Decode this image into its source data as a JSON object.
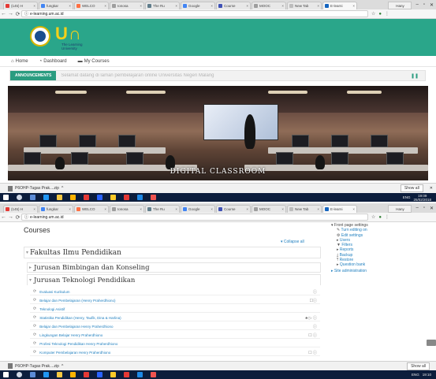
{
  "browser_top": {
    "tabs": [
      {
        "label": "(145) H",
        "color": "#e53935"
      },
      {
        "label": "fungkar",
        "color": "#4285f4"
      },
      {
        "label": "WELCO",
        "color": "#ff7043"
      },
      {
        "label": "Ionosa",
        "color": "#9e9e9e"
      },
      {
        "label": "The Ru",
        "color": "#607d8b"
      },
      {
        "label": "Google",
        "color": "#4285f4"
      },
      {
        "label": "Course",
        "color": "#3f51b5"
      },
      {
        "label": "MOOC",
        "color": "#9e9e9e"
      },
      {
        "label": "New Tab",
        "color": "#bdbdbd"
      },
      {
        "label": "E-learni",
        "color": "#1565c0"
      }
    ],
    "user": "Hany",
    "url": "e-learning.um.ac.id"
  },
  "moodle_top": {
    "logo_letters": "U∩",
    "logo_sub": "The Learning University",
    "nav": {
      "home": "Home",
      "dashboard": "Dashboard",
      "my_courses": "My Courses"
    },
    "announcement_label": "ANNOUNCEMENTS",
    "announcement_text": "Selamat datang di laman pembelajaran online Universitas Negeri Malang",
    "banner_caption": "DIGITAL CLASSROOM"
  },
  "download_top": {
    "file": "P6OHP-Tugas Prak....zip",
    "show_all": "Show all"
  },
  "taskbar_top": {
    "lang": "ENG",
    "time": "19:09",
    "date": "25/02/2018"
  },
  "browser_bottom": {
    "tabs": [
      {
        "label": "(145) H",
        "color": "#e53935"
      },
      {
        "label": "fungkar",
        "color": "#4285f4"
      },
      {
        "label": "WELCO",
        "color": "#ff7043"
      },
      {
        "label": "Ionosa",
        "color": "#9e9e9e"
      },
      {
        "label": "The Ru",
        "color": "#607d8b"
      },
      {
        "label": "Google",
        "color": "#4285f4"
      },
      {
        "label": "Course",
        "color": "#3f51b5"
      },
      {
        "label": "MOOC",
        "color": "#9e9e9e"
      },
      {
        "label": "New Tab",
        "color": "#bdbdbd"
      },
      {
        "label": "E-learni",
        "color": "#1565c0"
      }
    ],
    "user": "Hany",
    "url": "e-learning.um.ac.id"
  },
  "courses": {
    "title": "Courses",
    "collapse_all": "Collapse all",
    "faculty": "Fakultas Ilmu Pendidikan",
    "dept1": "Jurusan Bimbingan dan Konseling",
    "dept2": "Jurusan Teknologi Pendidikan",
    "rows": [
      "Evaluasi Kurikulum",
      "Belajar dan Pembelajaran (Henry Praherdhiono)",
      "Teknologi Asistif",
      "Statistika Pendidikan (Henry, Taufik, Dina & Harlina)",
      "Belajar dan Pembelajaran Henry Praherdhiono",
      "Lingkungan Belajar Henry Praherdhiono",
      "Profesi Teknologi Pendidikan Henry Praherdhiono",
      "Komputer Pembelajaran Henry Praherdhiono"
    ]
  },
  "settings_block": {
    "header": "Front page settings",
    "items": [
      "Turn editing on",
      "Edit settings",
      "Users",
      "Filters",
      "Reports",
      "Backup",
      "Restore",
      "Question bank"
    ],
    "site_admin": "Site administration"
  },
  "download_bottom": {
    "file": "P6OHP-Tugas Prak....zip",
    "show_all": "Show all"
  },
  "taskbar_bottom": {
    "lang": "ENG",
    "time": "19:10"
  }
}
